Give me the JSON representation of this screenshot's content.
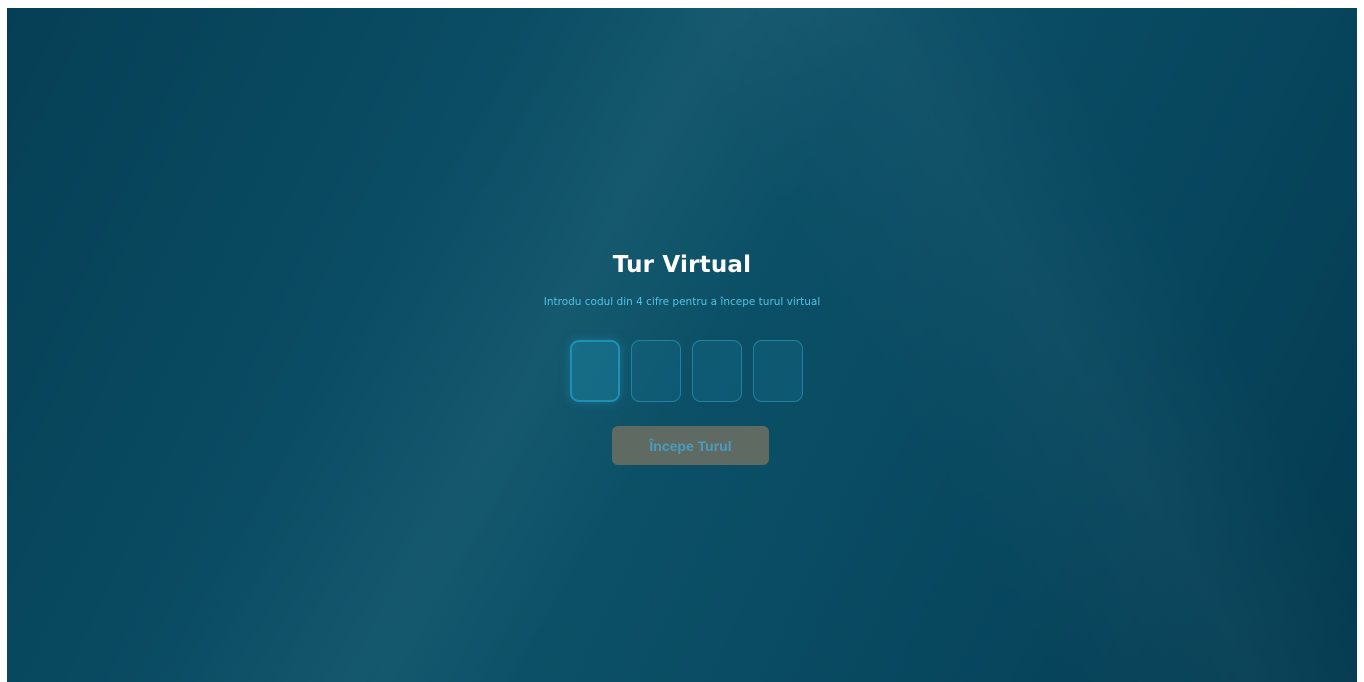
{
  "page": {
    "title": "Tur Virtual",
    "subtitle": "Introdu codul din 4 cifre pentru a începe turul virtual"
  },
  "code_inputs": [
    {
      "value": "",
      "focused": true
    },
    {
      "value": "",
      "focused": false
    },
    {
      "value": "",
      "focused": false
    },
    {
      "value": "",
      "focused": false
    }
  ],
  "start_button": {
    "label": "Începe Turul",
    "disabled": true
  },
  "colors": {
    "background": "#0a4c63",
    "title": "#ffffff",
    "subtitle": "#4fc3e3",
    "button_bg": "#5f6a62",
    "button_text": "#4a9cbf"
  }
}
